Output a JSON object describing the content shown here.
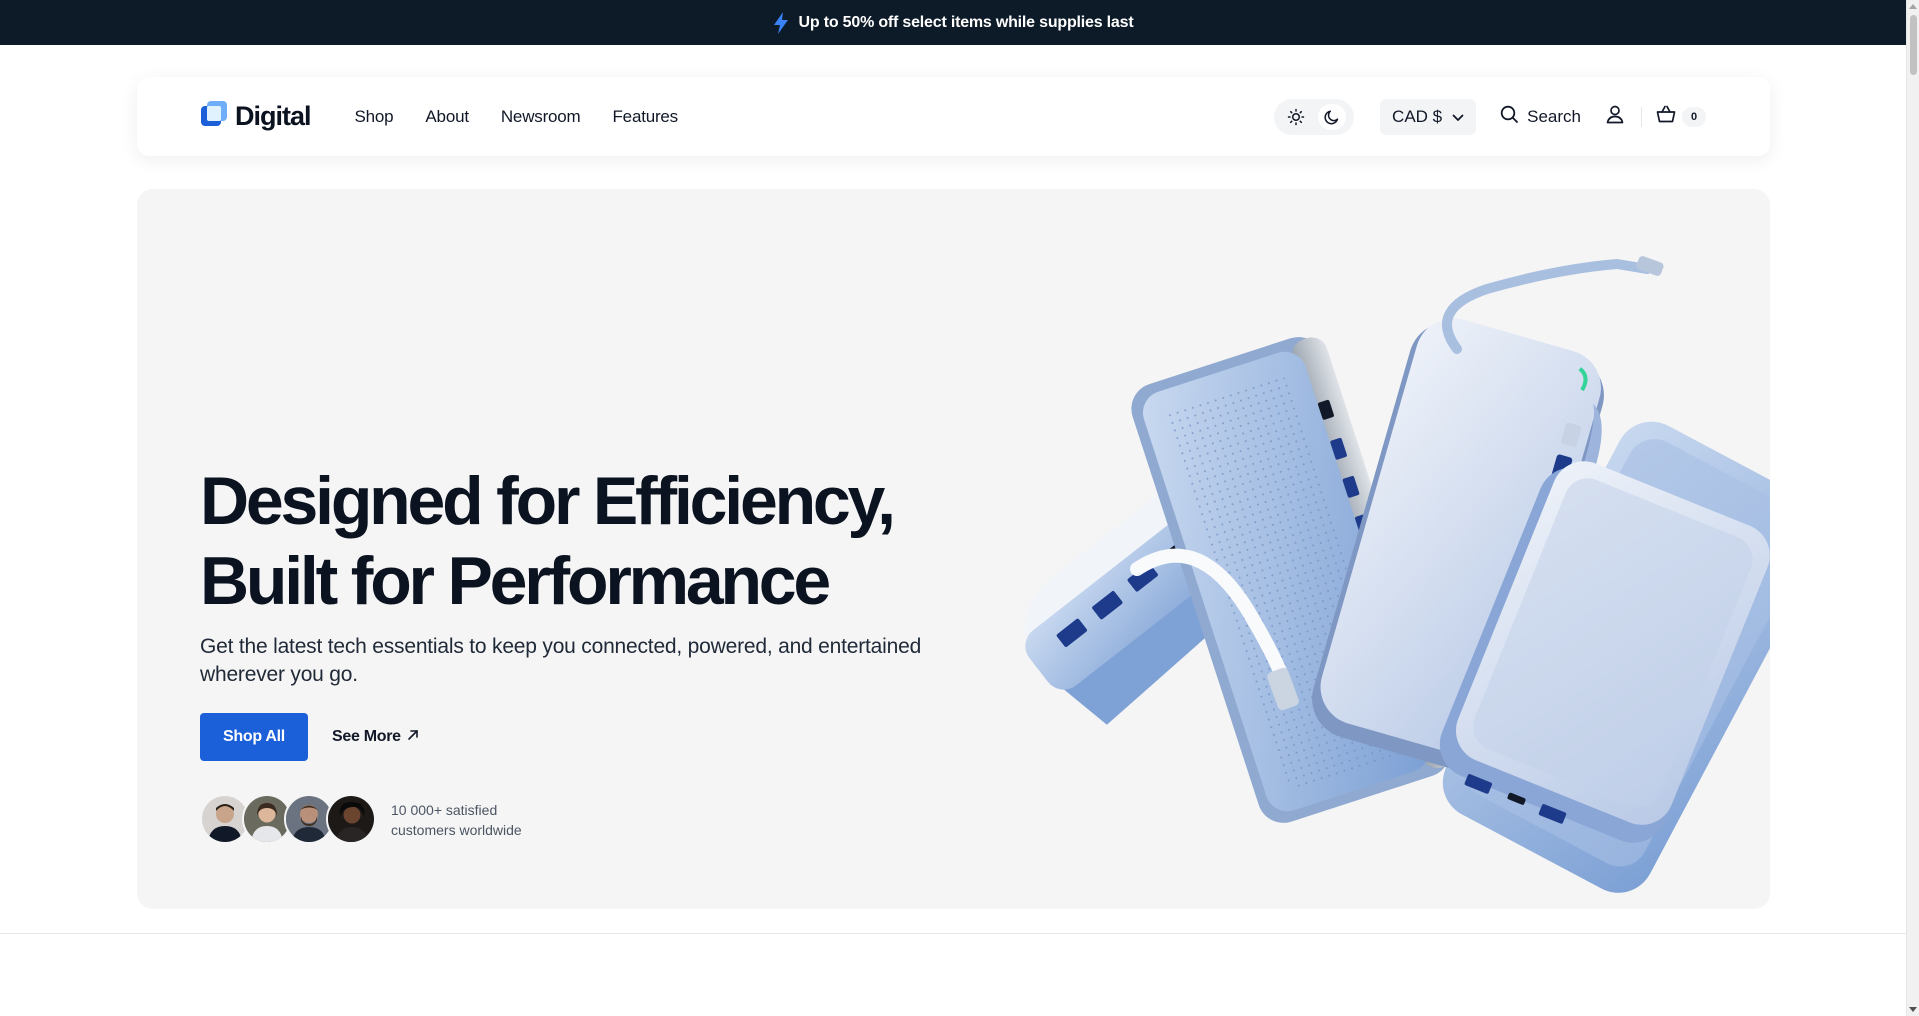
{
  "announcement": {
    "text": "Up to 50% off select items while supplies last"
  },
  "header": {
    "logo_text": "Digital",
    "nav": [
      "Shop",
      "About",
      "Newsroom",
      "Features"
    ],
    "currency": "CAD $",
    "search_label": "Search",
    "cart_count": "0"
  },
  "hero": {
    "title": "Designed for Efficiency, Built for Performance",
    "subtitle": "Get the latest tech essentials to keep you connected, powered, and entertained wherever you go.",
    "primary_cta": "Shop All",
    "secondary_cta": "See More",
    "social_proof_line1": "10 000+ satisfied",
    "social_proof_line2": "customers worldwide"
  },
  "colors": {
    "announcement_bg": "#0c1b27",
    "accent": "#1b5fd9",
    "bolt": "#3b82f6",
    "hero_bg": "#f5f5f5"
  },
  "icons": {
    "announcement": "lightning-bolt-icon",
    "theme_light": "sun-icon",
    "theme_dark": "moon-icon",
    "currency_dropdown": "chevron-down-icon",
    "search": "search-icon",
    "account": "user-icon",
    "cart": "shopping-basket-icon",
    "see_more": "arrow-up-right-icon"
  }
}
